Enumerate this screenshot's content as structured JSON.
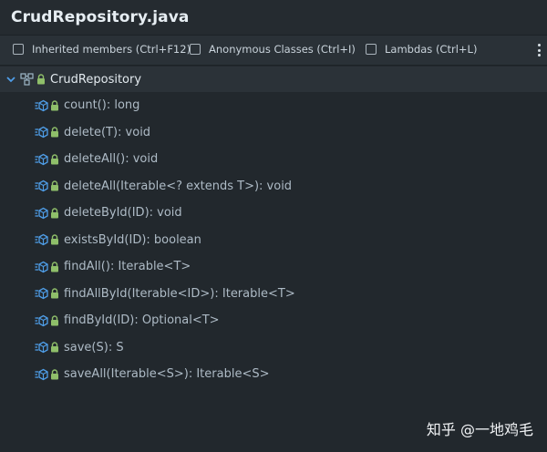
{
  "window": {
    "title": "CrudRepository.java"
  },
  "options": {
    "inherited_label": "Inherited members (Ctrl+F12)",
    "anonymous_label": "Anonymous Classes (Ctrl+I)",
    "lambdas_label": "Lambdas (Ctrl+L)"
  },
  "tree": {
    "root_label": "CrudRepository",
    "members": [
      "count(): long",
      "delete(T): void",
      "deleteAll(): void",
      "deleteAll(Iterable<? extends T>): void",
      "deleteById(ID): void",
      "existsById(ID): boolean",
      "findAll(): Iterable<T>",
      "findAllById(Iterable<ID>): Iterable<T>",
      "findById(ID): Optional<T>",
      "save(S): S",
      "saveAll(Iterable<S>): Iterable<S>"
    ]
  },
  "watermark": "知乎 @一地鸡毛",
  "colors": {
    "background": "#22282d",
    "method_icon": "#4f9ee8",
    "lock_icon": "#8fbf6a"
  }
}
